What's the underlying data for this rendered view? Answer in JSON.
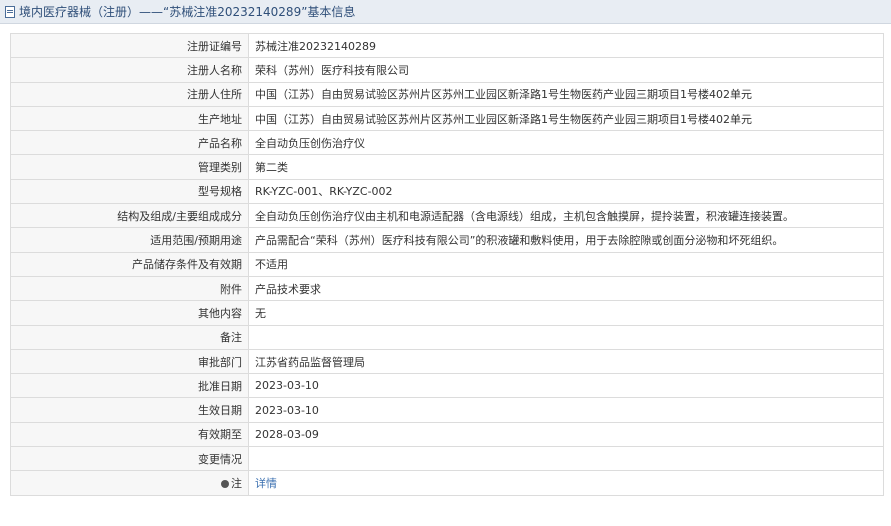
{
  "header": {
    "title": "境内医疗器械（注册）——“苏械注准20232140289”基本信息"
  },
  "rows": [
    {
      "label": "注册证编号",
      "value": "苏械注准20232140289"
    },
    {
      "label": "注册人名称",
      "value": "荣科（苏州）医疗科技有限公司"
    },
    {
      "label": "注册人住所",
      "value": "中国（江苏）自由贸易试验区苏州片区苏州工业园区新泽路1号生物医药产业园三期项目1号楼402单元"
    },
    {
      "label": "生产地址",
      "value": "中国（江苏）自由贸易试验区苏州片区苏州工业园区新泽路1号生物医药产业园三期项目1号楼402单元"
    },
    {
      "label": "产品名称",
      "value": "全自动负压创伤治疗仪"
    },
    {
      "label": "管理类别",
      "value": "第二类"
    },
    {
      "label": "型号规格",
      "value": "RK-YZC-001、RK-YZC-002"
    },
    {
      "label": "结构及组成/主要组成成分",
      "value": "全自动负压创伤治疗仪由主机和电源适配器（含电源线）组成，主机包含触摸屏，提拎装置，积液罐连接装置。"
    },
    {
      "label": "适用范围/预期用途",
      "value": "产品需配合“荣科（苏州）医疗科技有限公司”的积液罐和敷料使用，用于去除腔隙或创面分泌物和坏死组织。"
    },
    {
      "label": "产品储存条件及有效期",
      "value": "不适用"
    },
    {
      "label": "附件",
      "value": "产品技术要求"
    },
    {
      "label": "其他内容",
      "value": "无"
    },
    {
      "label": "备注",
      "value": ""
    },
    {
      "label": "审批部门",
      "value": "江苏省药品监督管理局"
    },
    {
      "label": "批准日期",
      "value": "2023-03-10"
    },
    {
      "label": "生效日期",
      "value": "2023-03-10"
    },
    {
      "label": "有效期至",
      "value": "2028-03-09"
    },
    {
      "label": "变更情况",
      "value": ""
    }
  ],
  "note_row": {
    "label": "注",
    "link_text": "详情",
    "icon": "note-icon"
  }
}
